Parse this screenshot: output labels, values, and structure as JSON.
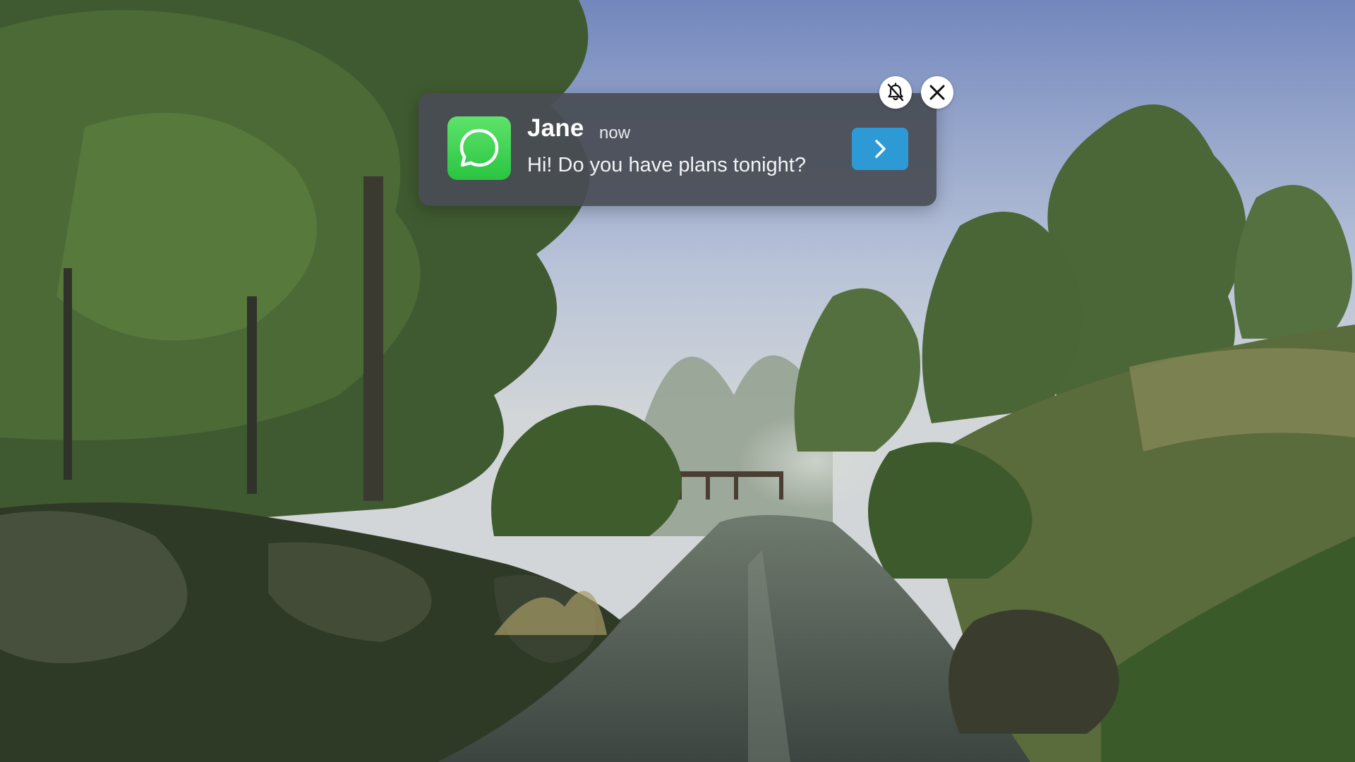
{
  "notification": {
    "sender": "Jane",
    "time": "now",
    "message": "Hi! Do you have plans tonight?",
    "app_icon": "whatsapp-icon",
    "app_color": "#2fc747",
    "open_button_color": "#2d9ad6"
  },
  "controls": {
    "mute_icon": "bell-off-icon",
    "close_icon": "close-icon"
  },
  "background": {
    "description_icon": "forest-river-scene"
  }
}
